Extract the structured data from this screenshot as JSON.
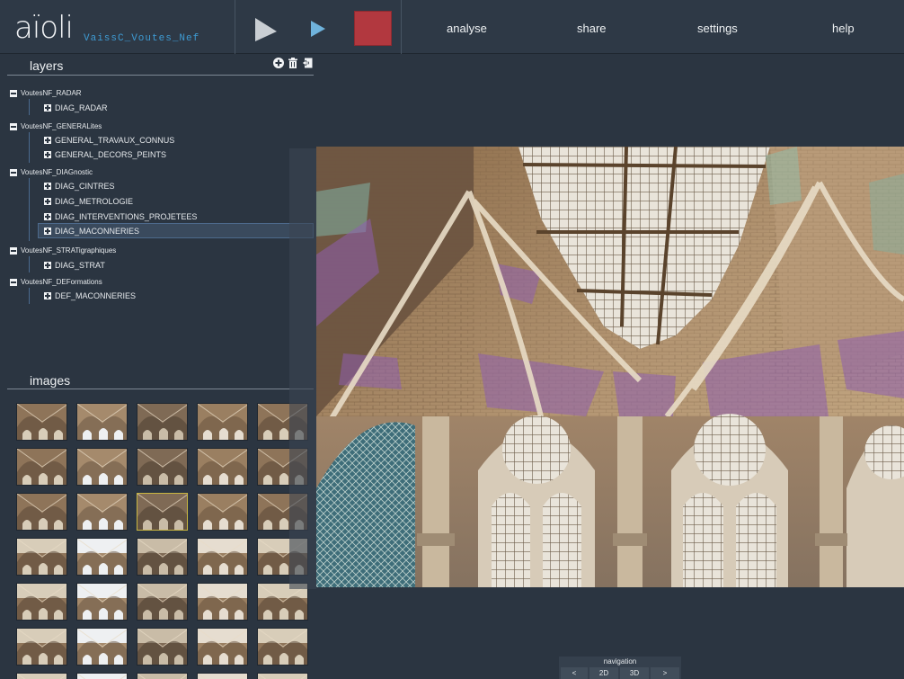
{
  "app": {
    "logo": "aïoli",
    "project_title": "VaissC_Voutes_Nef"
  },
  "toolbar": {
    "cursor_icon": "cursor-arrow-icon",
    "play_icon": "play-icon",
    "record_color": "#b2383f"
  },
  "menu": {
    "analyse": "analyse",
    "share": "share",
    "settings": "settings",
    "help": "help"
  },
  "layers_panel": {
    "title": "layers",
    "actions": [
      "add-icon",
      "trash-icon",
      "export-icon"
    ],
    "groups": [
      {
        "label": "VoutesNF_RADAR",
        "items": [
          "DIAG_RADAR"
        ]
      },
      {
        "label": "VoutesNF_GENERALites",
        "items": [
          "GENERAL_TRAVAUX_CONNUS",
          "GENERAL_DECORS_PEINTS"
        ]
      },
      {
        "label": "VoutesNF_DIAGnostic",
        "items": [
          "DIAG_CINTRES",
          "DIAG_METROLOGIE",
          "DIAG_INTERVENTIONS_PROJETEES",
          "DIAG_MACONNERIES"
        ]
      },
      {
        "label": "VoutesNF_STRATigraphiques",
        "items": [
          "DIAG_STRAT"
        ]
      },
      {
        "label": "VoutesNF_DEFormations",
        "items": [
          "DEF_MACONNERIES"
        ]
      }
    ],
    "selected_item": "DIAG_MACONNERIES"
  },
  "images_panel": {
    "title": "images",
    "selected_index": 12
  },
  "navigation": {
    "title": "navigation",
    "prev": "<",
    "mode_2d": "2D",
    "mode_3d": "3D",
    "next": ">"
  }
}
